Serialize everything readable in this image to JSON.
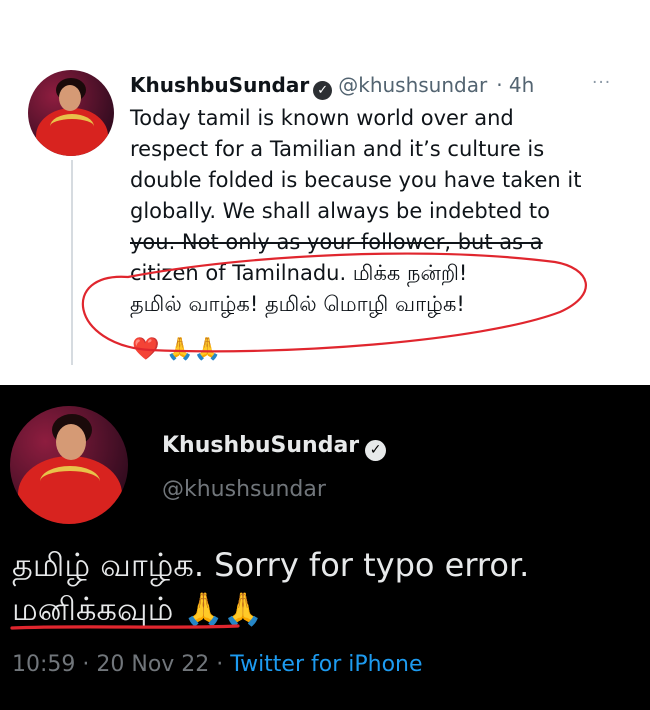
{
  "top_tweet": {
    "display_name": "KhushbuSundar",
    "verified_glyph": "✓",
    "handle": "@khushsundar",
    "time": "· 4h",
    "more_glyph": "···",
    "lines": [
      "Today tamil is known world over and",
      "respect for a Tamilian and it’s culture is",
      "double folded is because you have taken it",
      "globally. We shall always be indebted to",
      "you. Not only as your follower, but as a",
      "citizen of Tamilnadu. மிக்க நன்றி!",
      "தமில் வாழ்க! தமில் மொழி வாழ்க!"
    ],
    "emoji_heart": "❤️",
    "emoji_hands": "🙏🙏"
  },
  "bottom_tweet": {
    "display_name": "KhushbuSundar",
    "verified_glyph": "✓",
    "handle": "@khushsundar",
    "line1": "தமிழ் வாழ்க. Sorry for typo error.",
    "line2_word": "மனிக்கவும்",
    "line2_emoji": "🙏🙏",
    "timestamp": "10:59 · 20 Nov 22 ·",
    "source": "Twitter for iPhone"
  },
  "colors": {
    "annotation_red": "#e0262e",
    "link_blue": "#1d9bf0"
  }
}
